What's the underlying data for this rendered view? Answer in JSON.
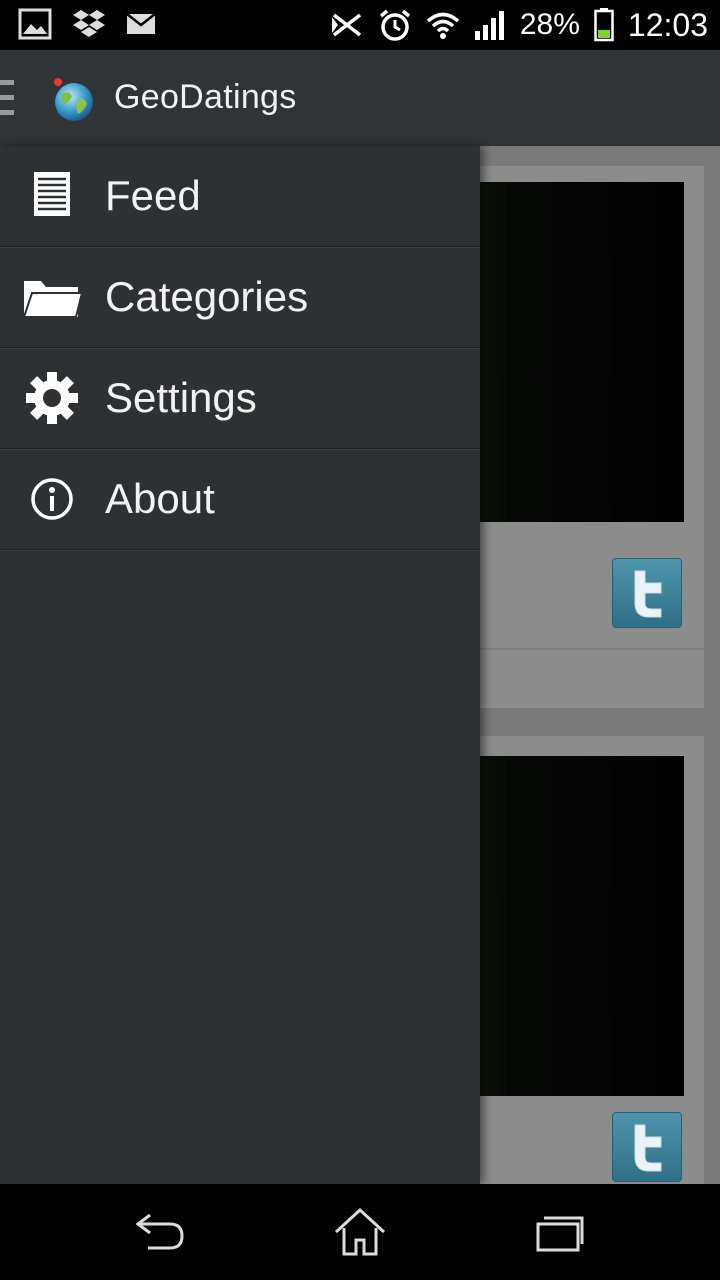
{
  "status_bar": {
    "left_icons": [
      "image-icon",
      "dropbox-icon",
      "mail-icon"
    ],
    "right_icons": [
      "nfc-icon",
      "alarm-icon",
      "wifi-icon",
      "signal-icon"
    ],
    "battery_percent": "28%",
    "battery_level": 0.28,
    "time": "12:03"
  },
  "action_bar": {
    "title": "GeoDatings",
    "icon": "globe-icon",
    "background": "#303436"
  },
  "drawer": {
    "background": "#2e3133",
    "items": [
      {
        "label": "Feed",
        "icon": "list-icon"
      },
      {
        "label": "Categories",
        "icon": "folder-icon"
      },
      {
        "label": "Settings",
        "icon": "gear-icon"
      },
      {
        "label": "About",
        "icon": "info-icon"
      }
    ]
  },
  "feed_cards": [
    {
      "share_icon": "twitter-icon"
    },
    {
      "share_icon": "twitter-icon"
    }
  ],
  "nav_bar": {
    "buttons": [
      "back-icon",
      "home-icon",
      "recent-apps-icon"
    ]
  }
}
